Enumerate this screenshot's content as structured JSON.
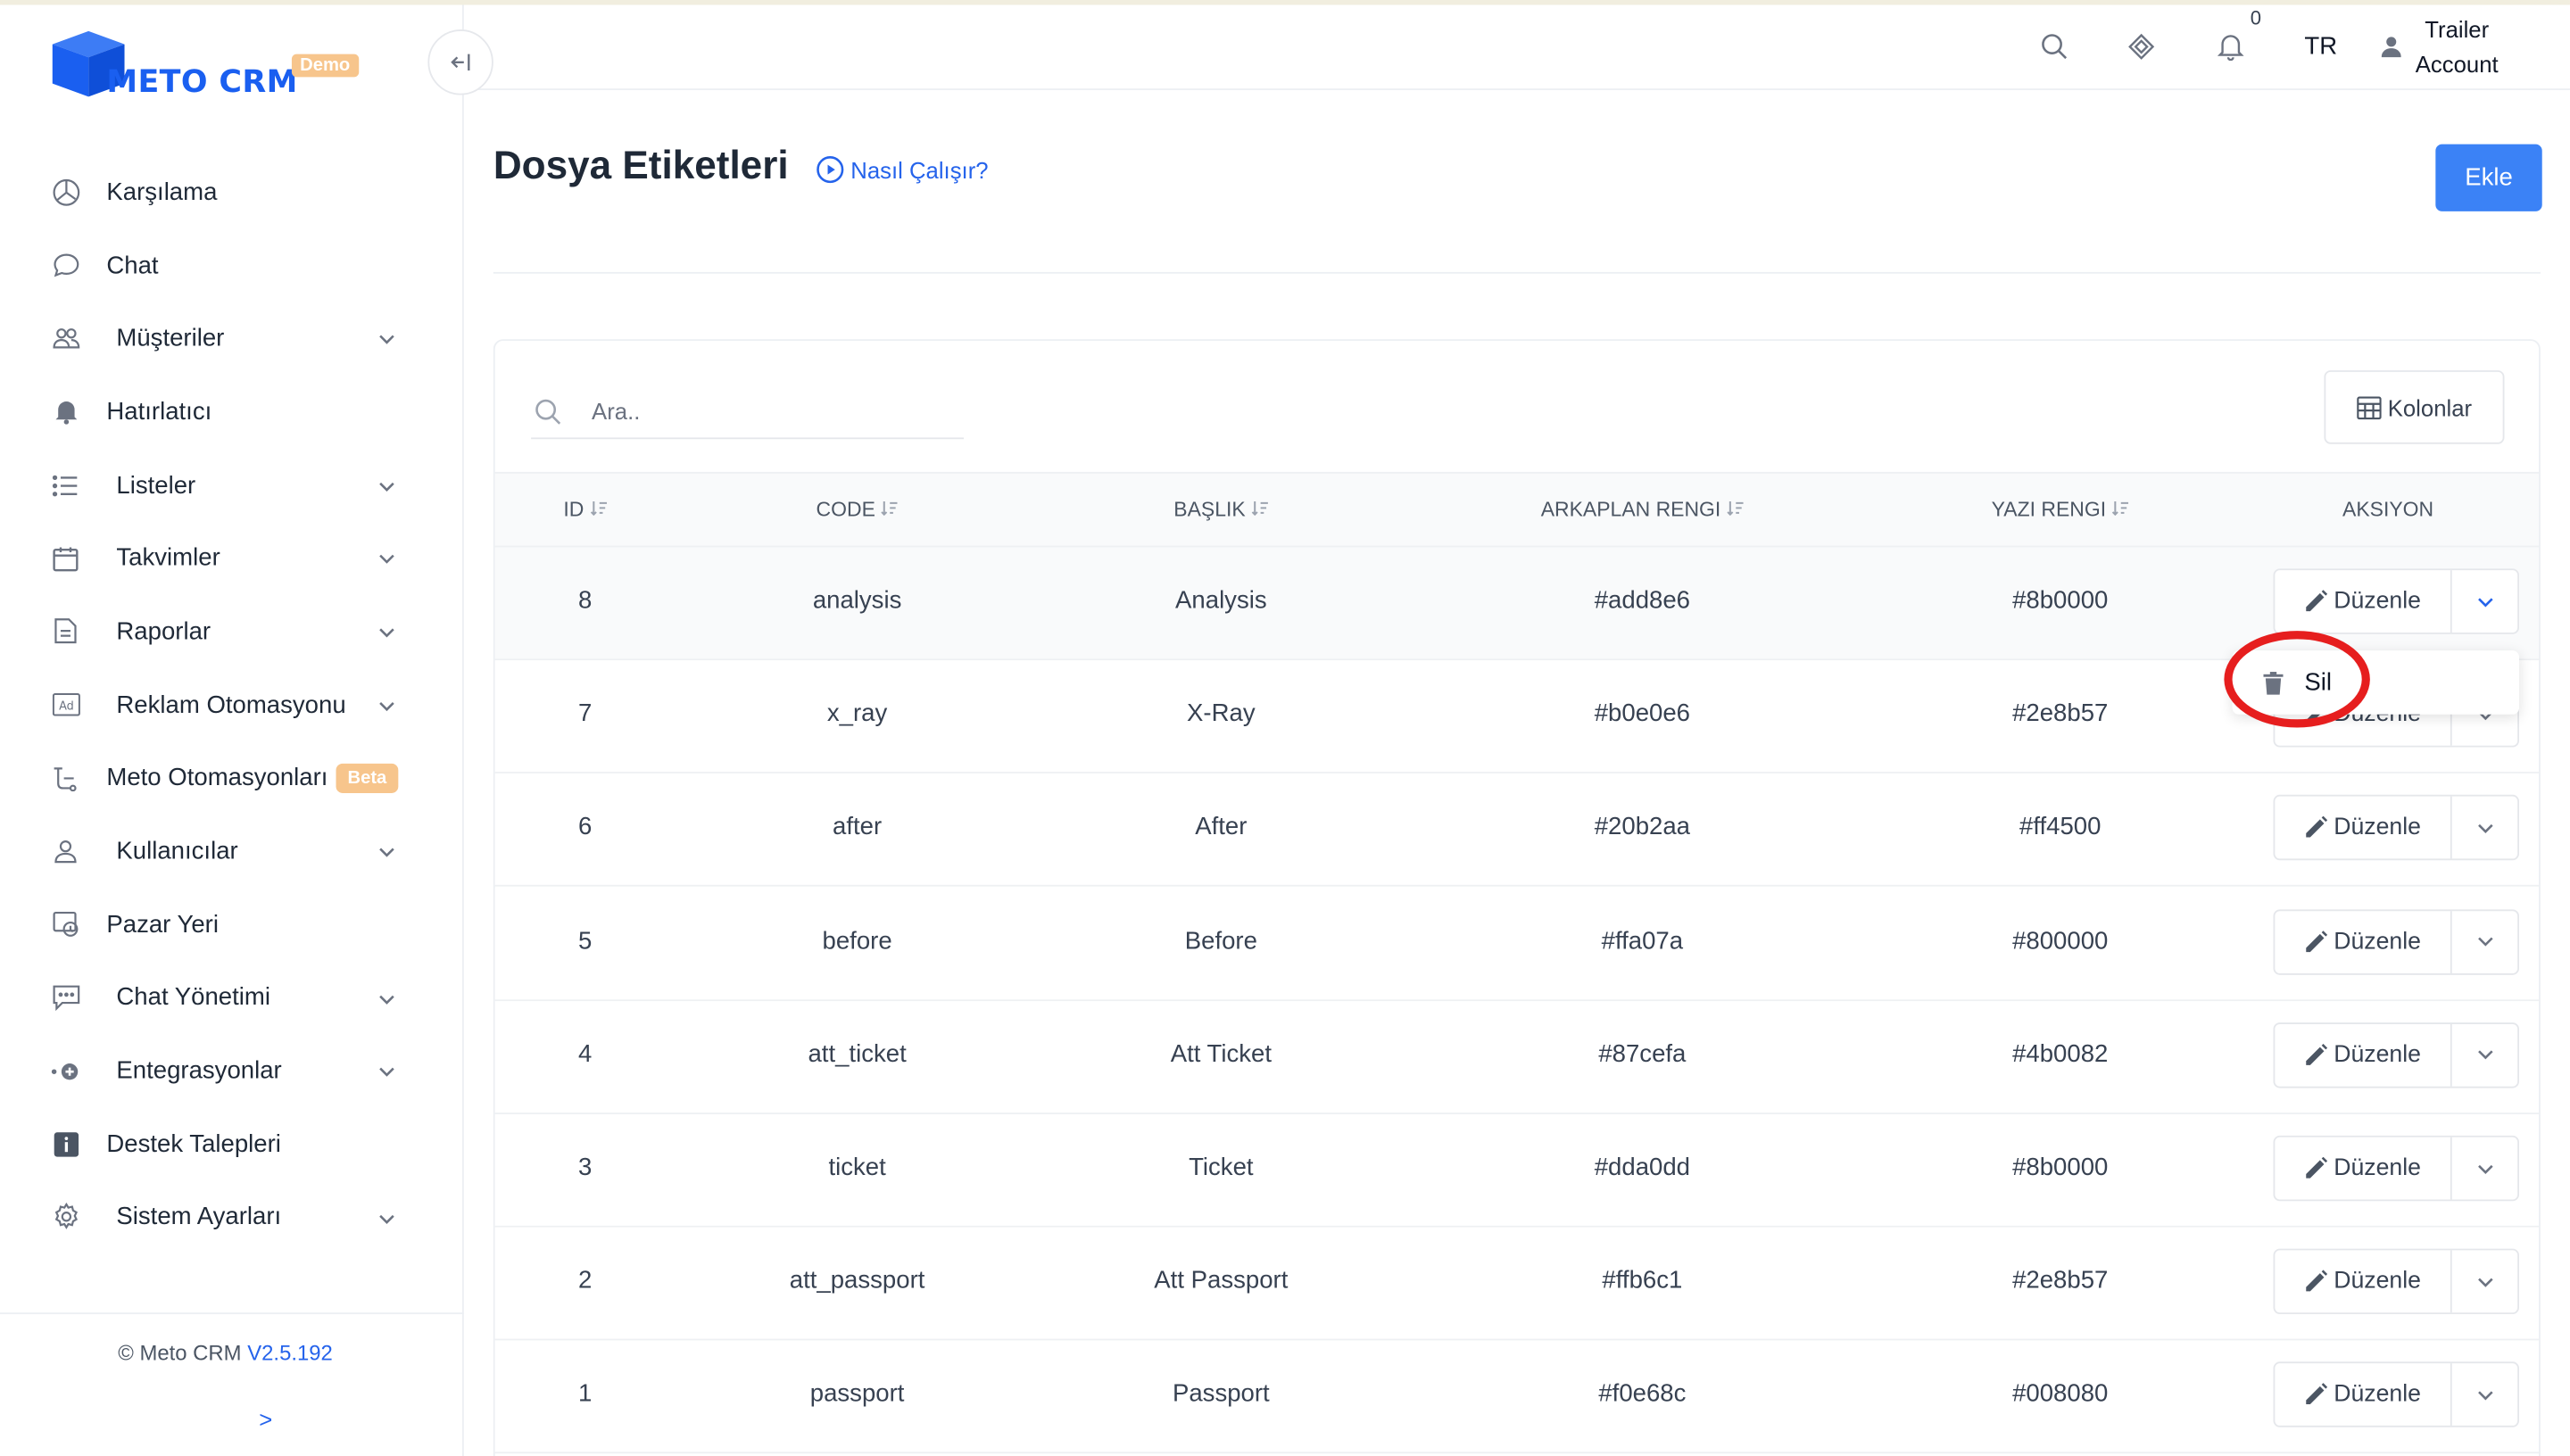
{
  "app": {
    "brand": "METO CRM",
    "badge": "Demo",
    "accent_color": "#3b82f6",
    "badge_color": "#f7c58c"
  },
  "sidebar": {
    "items": [
      {
        "label": "Karşılama",
        "icon": "dashboard-icon",
        "has_submenu": false
      },
      {
        "label": "Chat",
        "icon": "chat-bubble-icon",
        "has_submenu": false
      },
      {
        "label": "Müşteriler",
        "icon": "users-icon",
        "has_submenu": true
      },
      {
        "label": "Hatırlatıcı",
        "icon": "bell-icon",
        "has_submenu": false
      },
      {
        "label": "Listeler",
        "icon": "list-icon",
        "has_submenu": true
      },
      {
        "label": "Takvimler",
        "icon": "calendar-icon",
        "has_submenu": true
      },
      {
        "label": "Raporlar",
        "icon": "report-icon",
        "has_submenu": true
      },
      {
        "label": "Reklam Otomasyonu",
        "icon": "ad-icon",
        "has_submenu": true
      },
      {
        "label": "Meto Otomasyonları",
        "icon": "automation-icon",
        "has_submenu": false,
        "badge": "Beta"
      },
      {
        "label": "Kullanıcılar",
        "icon": "user-icon",
        "has_submenu": true
      },
      {
        "label": "Pazar Yeri",
        "icon": "marketplace-icon",
        "has_submenu": false
      },
      {
        "label": "Chat Yönetimi",
        "icon": "chat-manage-icon",
        "has_submenu": true
      },
      {
        "label": "Entegrasyonlar",
        "icon": "integration-icon",
        "has_submenu": true
      },
      {
        "label": "Destek Talepleri",
        "icon": "info-icon",
        "has_submenu": false
      },
      {
        "label": "Sistem Ayarları",
        "icon": "gear-icon",
        "has_submenu": true
      }
    ],
    "footer": {
      "copyright": "© Meto CRM",
      "version": "V2.5.192",
      "expand": ">"
    }
  },
  "header": {
    "notification_count": "0",
    "language": "TR",
    "user_line1": "Trailer",
    "user_line2": "Account"
  },
  "page": {
    "title": "Dosya Etiketleri",
    "how_it_works": "Nasıl Çalışır?",
    "add_button": "Ekle"
  },
  "table": {
    "search_placeholder": "Ara..",
    "columns_button": "Kolonlar",
    "headers": [
      "ID",
      "CODE",
      "BAŞLIK",
      "ARKAPLAN RENGI",
      "YAZI RENGI",
      "AKSIYON"
    ],
    "rows": [
      {
        "id": "8",
        "code": "analysis",
        "title": "Analysis",
        "bg": "#add8e6",
        "fg": "#8b0000"
      },
      {
        "id": "7",
        "code": "x_ray",
        "title": "X-Ray",
        "bg": "#b0e0e6",
        "fg": "#2e8b57"
      },
      {
        "id": "6",
        "code": "after",
        "title": "After",
        "bg": "#20b2aa",
        "fg": "#ff4500"
      },
      {
        "id": "5",
        "code": "before",
        "title": "Before",
        "bg": "#ffa07a",
        "fg": "#800000"
      },
      {
        "id": "4",
        "code": "att_ticket",
        "title": "Att Ticket",
        "bg": "#87cefa",
        "fg": "#4b0082"
      },
      {
        "id": "3",
        "code": "ticket",
        "title": "Ticket",
        "bg": "#dda0dd",
        "fg": "#8b0000"
      },
      {
        "id": "2",
        "code": "att_passport",
        "title": "Att Passport",
        "bg": "#ffb6c1",
        "fg": "#2e8b57"
      },
      {
        "id": "1",
        "code": "passport",
        "title": "Passport",
        "bg": "#f0e68c",
        "fg": "#008080"
      }
    ],
    "edit_label": "Düzenle",
    "delete_label": "Sil",
    "highlight_color": "#e61e1e"
  }
}
